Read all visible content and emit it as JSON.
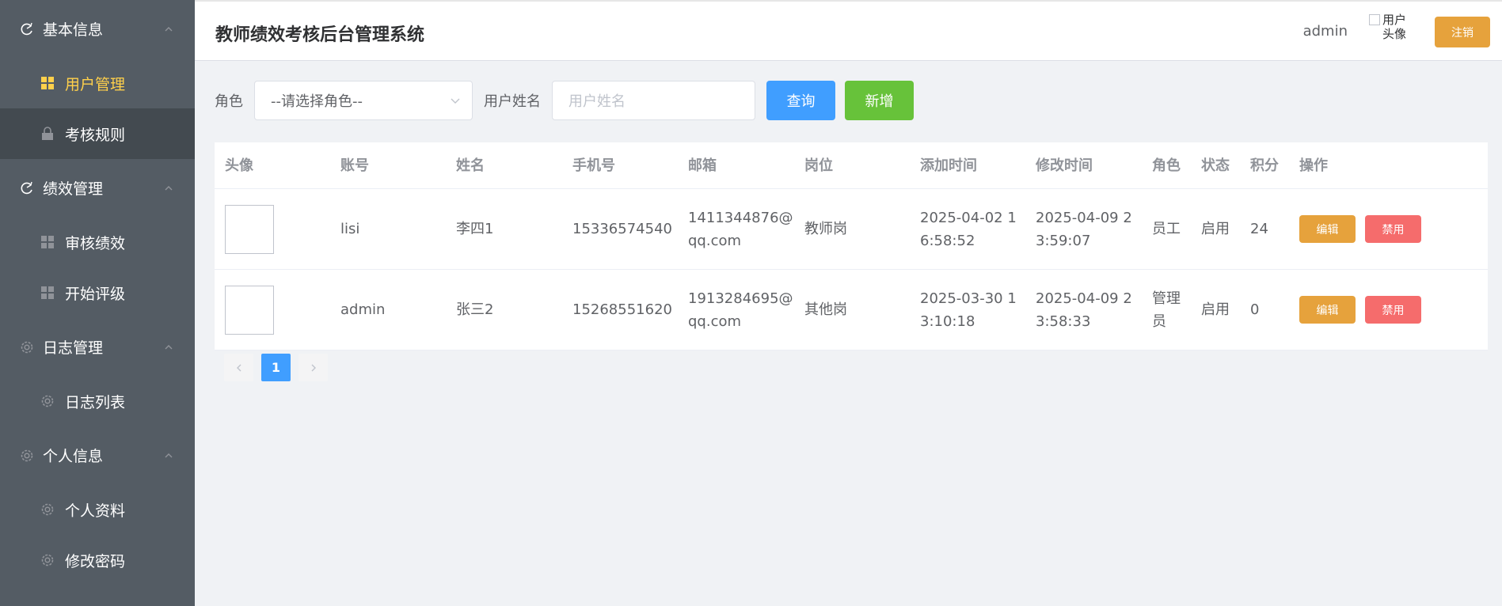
{
  "app": {
    "title": "教师绩效考核后台管理系统"
  },
  "header": {
    "user": "admin",
    "avatar_alt": "用户头像",
    "logout_label": "注销"
  },
  "sidebar": {
    "groups": [
      {
        "title": "基本信息",
        "items": [
          {
            "label": "用户管理",
            "icon": "grid-icon",
            "active": true
          },
          {
            "label": "考核规则",
            "icon": "lock-icon"
          }
        ]
      },
      {
        "title": "绩效管理",
        "items": [
          {
            "label": "审核绩效",
            "icon": "grid-icon"
          },
          {
            "label": "开始评级",
            "icon": "grid-icon"
          }
        ]
      },
      {
        "title": "日志管理",
        "items": [
          {
            "label": "日志列表",
            "icon": "gear-icon"
          }
        ]
      },
      {
        "title": "个人信息",
        "items": [
          {
            "label": "个人资料",
            "icon": "gear-icon"
          },
          {
            "label": "修改密码",
            "icon": "gear-icon"
          }
        ]
      }
    ]
  },
  "search": {
    "role_label": "角色",
    "role_placeholder": "--请选择角色--",
    "name_label": "用户姓名",
    "name_placeholder": "用户姓名",
    "query_label": "查询",
    "add_label": "新增"
  },
  "table": {
    "columns": [
      "头像",
      "账号",
      "姓名",
      "手机号",
      "邮箱",
      "岗位",
      "添加时间",
      "修改时间",
      "角色",
      "状态",
      "积分",
      "操作"
    ],
    "rows": [
      {
        "account": "lisi",
        "name": "李四1",
        "phone": "15336574540",
        "email": "1411344876@qq.com",
        "post": "教师岗",
        "added": "2025-04-02 16:58:52",
        "modified": "2025-04-09 23:59:07",
        "role": "员工",
        "status": "启用",
        "points": "24",
        "edit": "编辑",
        "disable": "禁用"
      },
      {
        "account": "admin",
        "name": "张三2",
        "phone": "15268551620",
        "email": "1913284695@qq.com",
        "post": "其他岗",
        "added": "2025-03-30 13:10:18",
        "modified": "2025-04-09 23:58:33",
        "role": "管理员",
        "status": "启用",
        "points": "0",
        "edit": "编辑",
        "disable": "禁用"
      }
    ]
  },
  "pagination": {
    "current": "1"
  },
  "colors": {
    "sidebar_bg": "#545c64",
    "active": "#ffd04b",
    "primary": "#409eff",
    "success": "#67c23a",
    "warning": "#e6a23c",
    "danger": "#f56c6c"
  }
}
